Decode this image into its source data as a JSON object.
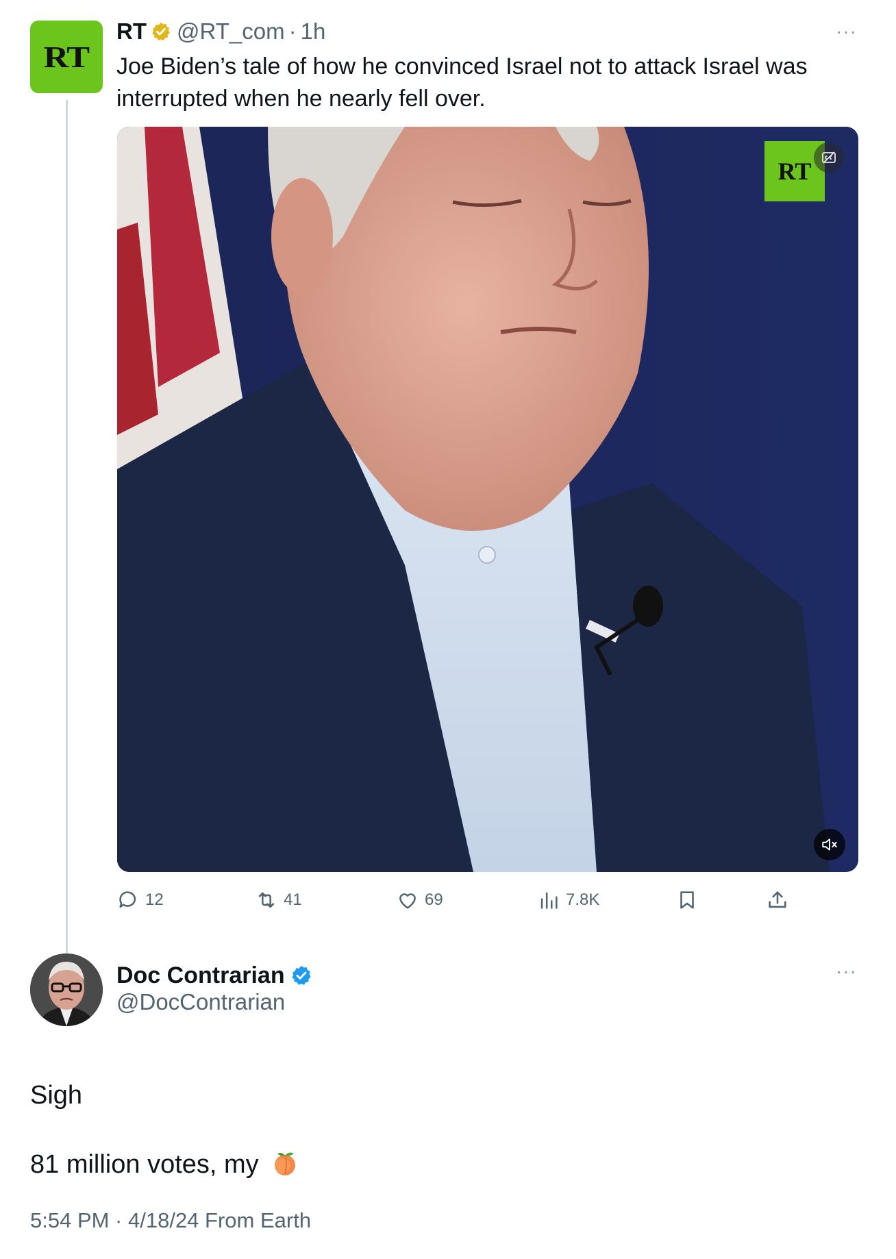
{
  "quoted_tweet": {
    "avatar_text": "RT",
    "name": "RT",
    "verified_badge": "gold-check-badge-icon",
    "handle": "@RT_com",
    "separator": "·",
    "time": "1h",
    "more_icon": "more-dots-icon",
    "more_label": "···",
    "text": "Joe Biden’s tale of how he convinced Israel not to attack Israel was interrupted when he nearly fell over.",
    "video": {
      "watermark": "RT",
      "captions_icon": "closed-captions-icon",
      "mute_icon": "muted-speaker-icon"
    },
    "actions": {
      "replies": "12",
      "retweets": "41",
      "likes": "69",
      "views": "7.8K",
      "bookmark_icon": "bookmark-icon",
      "share_icon": "share-icon"
    }
  },
  "reply_tweet": {
    "name": "Doc Contrarian",
    "verified_badge": "blue-check-badge-icon",
    "handle": "@DocContrarian",
    "more_label": "···",
    "lines": [
      "Sigh",
      "81 million votes, my"
    ],
    "emoji": "peach-emoji-icon",
    "footer": "5:54 PM · 4/18/24 From Earth"
  },
  "colors": {
    "rt_green": "#6cc51c",
    "verified_gold": "#e2b719",
    "verified_blue": "#1d9bf0",
    "secondary_text": "#536471"
  }
}
